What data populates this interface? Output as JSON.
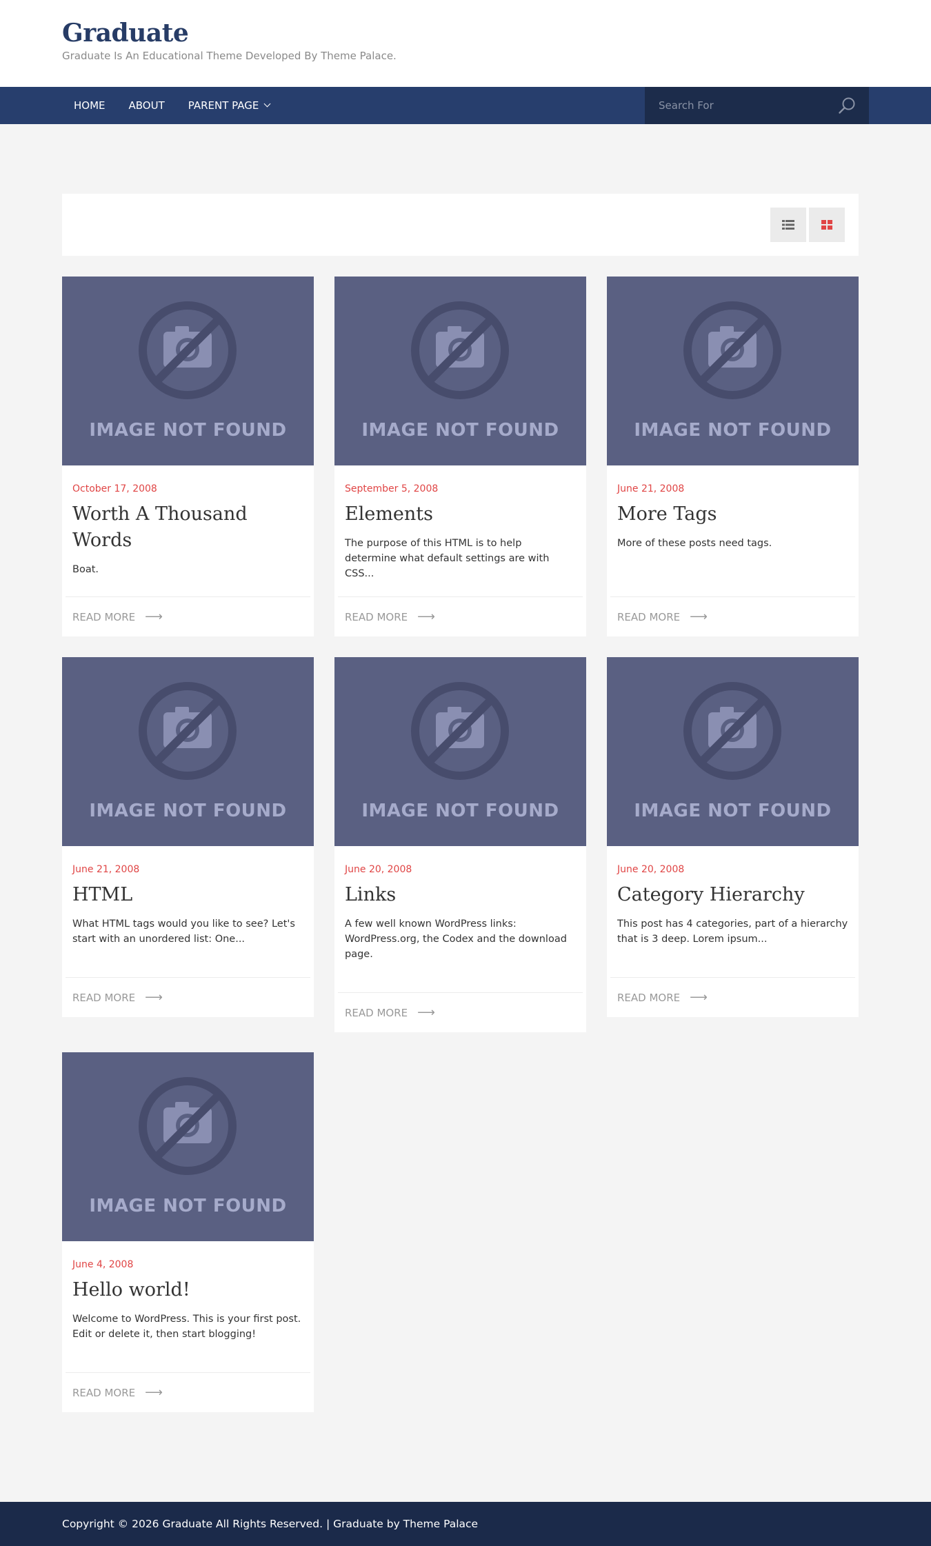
{
  "header": {
    "site_title": "Graduate",
    "site_description": "Graduate Is An Educational Theme Developed By Theme Palace."
  },
  "nav": {
    "items": [
      {
        "label": "HOME"
      },
      {
        "label": "ABOUT"
      },
      {
        "label": "PARENT PAGE",
        "has_dropdown": true
      }
    ],
    "search": {
      "placeholder": "Search For",
      "icon": "search-icon"
    }
  },
  "view_toggle": {
    "list_icon": "list-view-icon",
    "grid_icon": "grid-view-icon",
    "active": "grid",
    "active_color": "#e04545"
  },
  "posts": [
    {
      "date": "October 17, 2008",
      "title": "Worth A Thousand Words",
      "excerpt": "Boat.",
      "image_text": "IMAGE NOT FOUND",
      "read_more": "READ MORE"
    },
    {
      "date": "September 5, 2008",
      "title": "Elements",
      "excerpt": "The purpose of this HTML is to help determine what default settings are with CSS...",
      "image_text": "IMAGE NOT FOUND",
      "read_more": "READ MORE"
    },
    {
      "date": "June 21, 2008",
      "title": "More Tags",
      "excerpt": "More of these posts need tags.",
      "image_text": "IMAGE NOT FOUND",
      "read_more": "READ MORE"
    },
    {
      "date": "June 21, 2008",
      "title": "HTML",
      "excerpt": "What HTML tags would you like to see? Let's start with an unordered list: One...",
      "image_text": "IMAGE NOT FOUND",
      "read_more": "READ MORE"
    },
    {
      "date": "June 20, 2008",
      "title": "Links",
      "excerpt": "A few well known WordPress links: WordPress.org, the Codex and the download page.",
      "image_text": "IMAGE NOT FOUND",
      "read_more": "READ MORE"
    },
    {
      "date": "June 20, 2008",
      "title": "Category Hierarchy",
      "excerpt": "This post has 4 categories, part of a hierarchy that is 3 deep. Lorem ipsum...",
      "image_text": "IMAGE NOT FOUND",
      "read_more": "READ MORE"
    },
    {
      "date": "June 4, 2008",
      "title": "Hello world!",
      "excerpt": "Welcome to WordPress. This is your first post. Edit or delete it, then start blogging!",
      "image_text": "IMAGE NOT FOUND",
      "read_more": "READ MORE"
    }
  ],
  "footer": {
    "copyright": "Copyright © 2026 Graduate All Rights Reserved. | Graduate by Theme Palace"
  },
  "colors": {
    "nav_bg": "#273e6d",
    "search_bg": "#1c2c4b",
    "date": "#e04545",
    "footer_bg": "#1b2a4a"
  }
}
